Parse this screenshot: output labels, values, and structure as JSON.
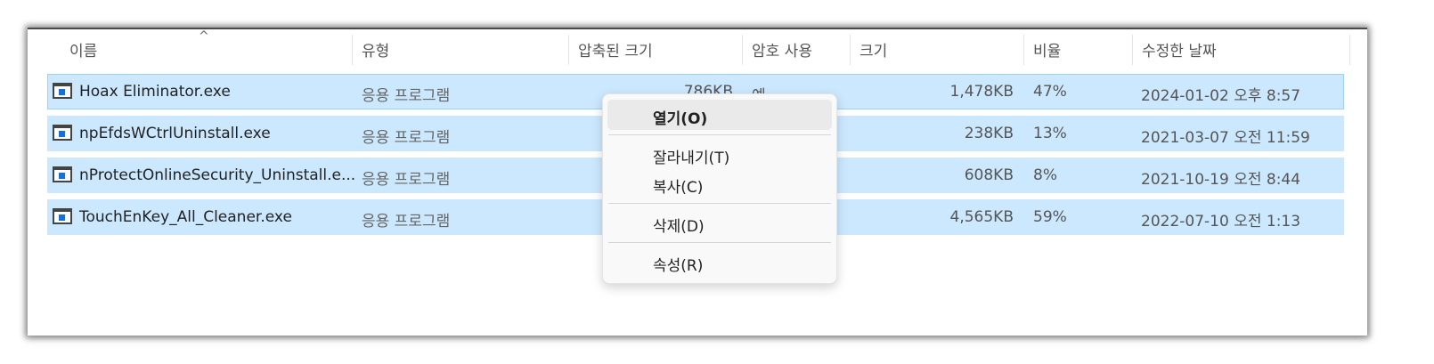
{
  "columns": {
    "name": "이름",
    "type": "유형",
    "compressed": "압축된 크기",
    "password": "암호 사용",
    "size": "크기",
    "ratio": "비율",
    "modified": "수정한 날짜"
  },
  "sort_indicator": "^",
  "rows": [
    {
      "name": "Hoax Eliminator.exe",
      "type": "응용 프로그램",
      "compressed": "786KB",
      "password": "예",
      "size": "1,478KB",
      "ratio": "47%",
      "date": "2024-01-02 오후 8:57"
    },
    {
      "name": "npEfdsWCtrlUninstall.exe",
      "type": "응용 프로그램",
      "compressed": "",
      "password": "",
      "size": "238KB",
      "ratio": "13%",
      "date": "2021-03-07 오전 11:59"
    },
    {
      "name": "nProtectOnlineSecurity_Uninstall.e...",
      "type": "응용 프로그램",
      "compressed": "",
      "password": "",
      "size": "608KB",
      "ratio": "8%",
      "date": "2021-10-19 오전 8:44"
    },
    {
      "name": "TouchEnKey_All_Cleaner.exe",
      "type": "응용 프로그램",
      "compressed": "",
      "password": "",
      "size": "4,565KB",
      "ratio": "59%",
      "date": "2022-07-10 오전 1:13"
    }
  ],
  "context_menu": {
    "open": "열기(O)",
    "cut": "잘라내기(T)",
    "copy": "복사(C)",
    "delete": "삭제(D)",
    "properties": "속성(R)"
  },
  "icons": {
    "file": "application-exe-icon"
  },
  "colors": {
    "selection": "#cce8ff",
    "selection_border": "#99d1ff",
    "menu_bg": "#f9f9f9"
  }
}
